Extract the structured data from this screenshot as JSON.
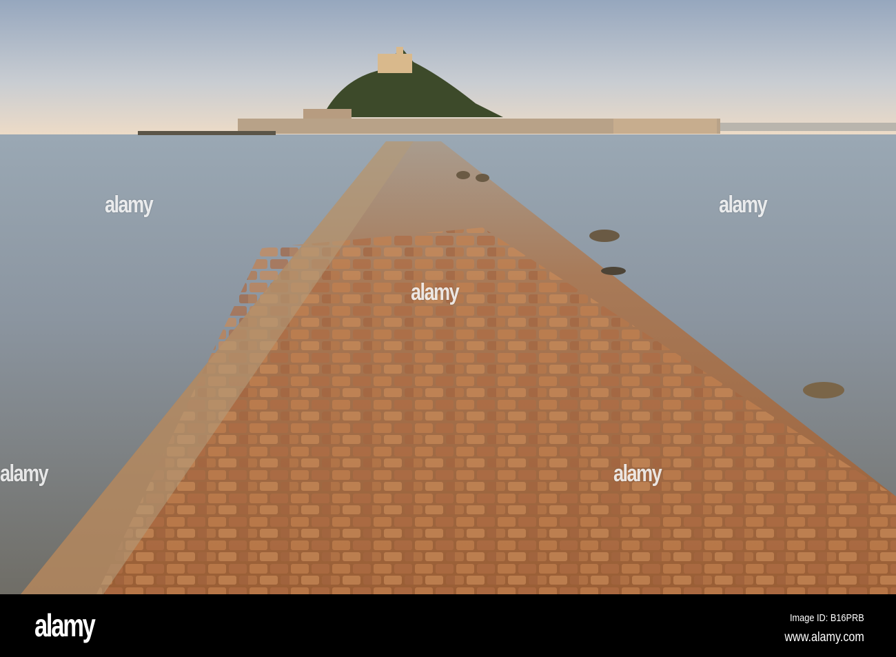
{
  "photo": {
    "subject": "cobbled causeway to island castle at low tide"
  },
  "watermark": {
    "text": "alamy"
  },
  "footer": {
    "logo": "alamy",
    "image_id": "Image ID: B16PRB",
    "website": "www.alamy.com"
  },
  "colors": {
    "footer_bg": "#000000",
    "footer_text": "#ffffff"
  }
}
